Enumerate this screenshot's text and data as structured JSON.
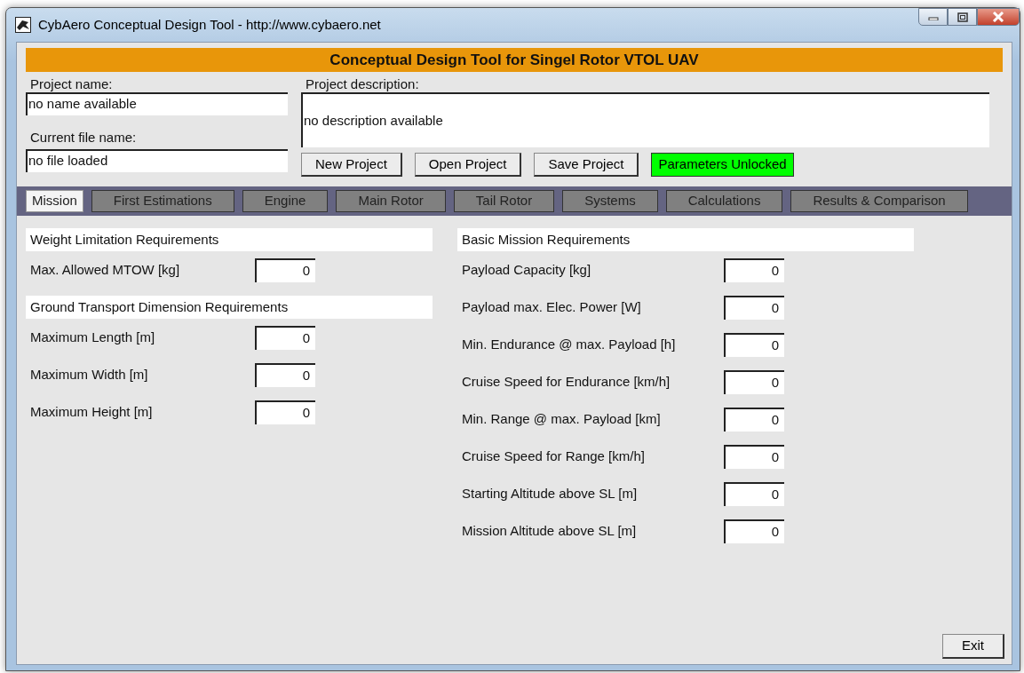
{
  "window": {
    "title": "CybAero Conceptual Design Tool - http://www.cybaero.net"
  },
  "banner": "Conceptual Design Tool for Singel Rotor VTOL UAV",
  "project": {
    "name_label": "Project name:",
    "name_value": "no name available",
    "file_label": "Current file name:",
    "file_value": "no file loaded",
    "description_label": "Project description:",
    "description_value": "no description available"
  },
  "buttons": [
    "New Project",
    "Open Project",
    "Save Project"
  ],
  "lock_toggle": {
    "label": "Parameters Unlocked",
    "locked": false
  },
  "tabs": [
    {
      "label": "Mission",
      "selected": true
    },
    {
      "label": "First Estimations",
      "selected": false
    },
    {
      "label": "Engine",
      "selected": false
    },
    {
      "label": "Main Rotor",
      "selected": false
    },
    {
      "label": "Tail Rotor",
      "selected": false
    },
    {
      "label": "Systems",
      "selected": false
    },
    {
      "label": "Calculations",
      "selected": false
    },
    {
      "label": "Results & Comparison",
      "selected": false
    }
  ],
  "columns": [
    {
      "sections": [
        {
          "title": "Weight Limitation Requirements",
          "fields": [
            {
              "label": "Max. Allowed MTOW [kg]",
              "value": "0"
            }
          ]
        },
        {
          "title": "Ground Transport Dimension Requirements",
          "fields": [
            {
              "label": "Maximum Length [m]",
              "value": "0"
            },
            {
              "label": "Maximum Width [m]",
              "value": "0"
            },
            {
              "label": "Maximum Height [m]",
              "value": "0"
            }
          ]
        }
      ]
    },
    {
      "sections": [
        {
          "title": "Basic Mission Requirements",
          "fields": [
            {
              "label": "Payload Capacity [kg]",
              "value": "0"
            },
            {
              "label": "Payload max. Elec. Power [W]",
              "value": "0"
            },
            {
              "label": "Min. Endurance @ max. Payload [h]",
              "value": "0"
            },
            {
              "label": "Cruise Speed for Endurance [km/h]",
              "value": "0"
            },
            {
              "label": "Min. Range @ max. Payload [km]",
              "value": "0"
            },
            {
              "label": "Cruise Speed for Range [km/h]",
              "value": "0"
            },
            {
              "label": "Starting Altitude above SL [m]",
              "value": "0"
            },
            {
              "label": "Mission Altitude above SL [m]",
              "value": "0"
            }
          ]
        }
      ]
    }
  ],
  "exit_button": "Exit"
}
